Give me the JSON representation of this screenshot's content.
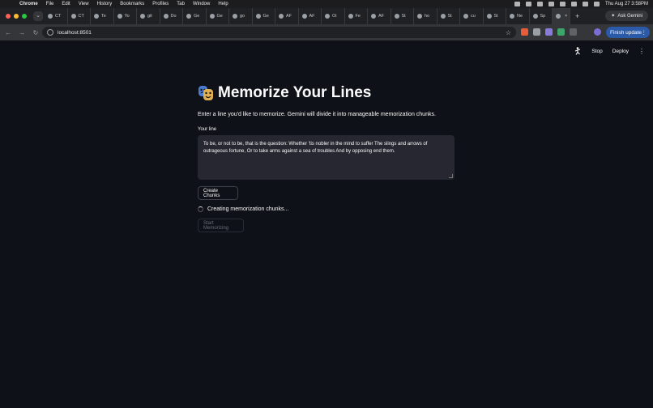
{
  "menubar": {
    "app": "Chrome",
    "items": [
      "File",
      "Edit",
      "View",
      "History",
      "Bookmarks",
      "Profiles",
      "Tab",
      "Window",
      "Help"
    ],
    "clock": "Thu Aug 27  3:58PM"
  },
  "tabs": [
    "CT",
    "CT",
    "Te",
    "Yo",
    "git",
    "Do",
    "Ge",
    "Ge",
    "go",
    "Ge",
    "AF",
    "AF",
    "Oi",
    "Fe",
    "AF",
    "St",
    "ho",
    "St",
    "cu",
    "St",
    "Ne",
    "Sp",
    ""
  ],
  "tabstrip": {
    "ask_gemini": "Ask Gemini",
    "new_tab": "+"
  },
  "toolbar": {
    "url": "localhost:8501",
    "finish_update": "Finish update"
  },
  "app_header": {
    "stop": "Stop",
    "deploy": "Deploy"
  },
  "main": {
    "title": "Memorize Your Lines",
    "subtitle": "Enter a line you'd like to memorize. Gemini will divide it into manageable memorization chunks.",
    "field_label": "Your line",
    "line_text": "To be, or not to be, that is the question: Whether 'tis nobler in the mind to suffer The slings and arrows of outrageous fortune, Or to take arms against a sea of troubles And by opposing end them.",
    "create_button": "Create Chunks",
    "status": "Creating memorization chunks...",
    "start_button": "Start Memorizing"
  },
  "colors": {
    "background": "#0e1117",
    "input_bg": "#262730",
    "accent": "#2b5aa8"
  }
}
